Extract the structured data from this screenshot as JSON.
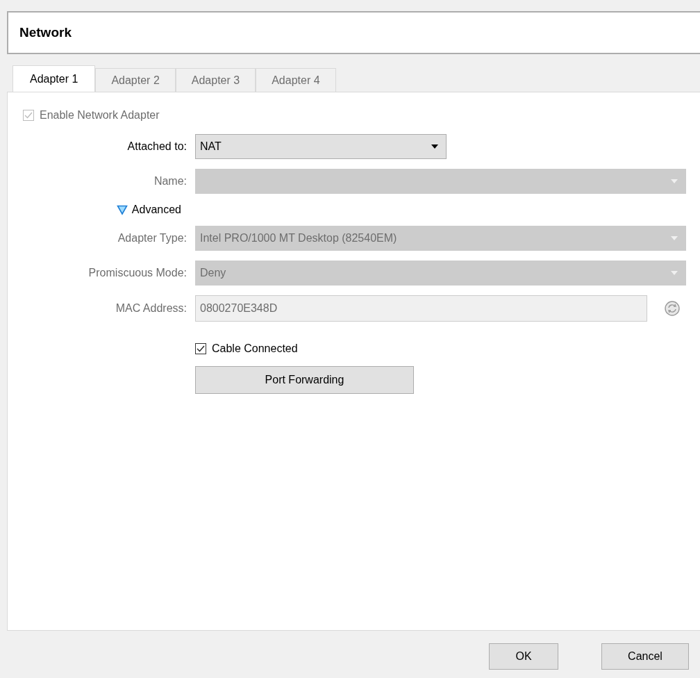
{
  "header": {
    "title": "Network"
  },
  "tabs": [
    {
      "label": "Adapter 1",
      "selected": true
    },
    {
      "label": "Adapter 2",
      "selected": false
    },
    {
      "label": "Adapter 3",
      "selected": false
    },
    {
      "label": "Adapter 4",
      "selected": false
    }
  ],
  "enable_adapter": {
    "label": "Enable Network Adapter",
    "checked": true,
    "disabled": true
  },
  "fields": [
    {
      "kind": "combo",
      "label": "Attached to:",
      "value": "NAT",
      "disabled": false
    },
    {
      "kind": "combo",
      "label": "Name:",
      "disabled": true
    }
  ],
  "advanced": {
    "label": "Advanced",
    "expanded": true
  },
  "advanced_fields": [
    {
      "kind": "combo",
      "label": "Adapter Type:",
      "value": "Intel PRO/1000 MT Desktop (82540EM)",
      "disabled": true
    },
    {
      "kind": "combo",
      "label": "Promiscuous Mode:",
      "value": "Deny",
      "disabled": true
    },
    {
      "kind": "text",
      "label": "MAC Address:",
      "value": "0800270E348D",
      "disabled": true
    }
  ],
  "cable_connected": {
    "label": "Cable Connected",
    "checked": true,
    "disabled": false
  },
  "port_forwarding": {
    "label": "Port Forwarding"
  },
  "buttons": [
    "OK",
    "Cancel"
  ]
}
